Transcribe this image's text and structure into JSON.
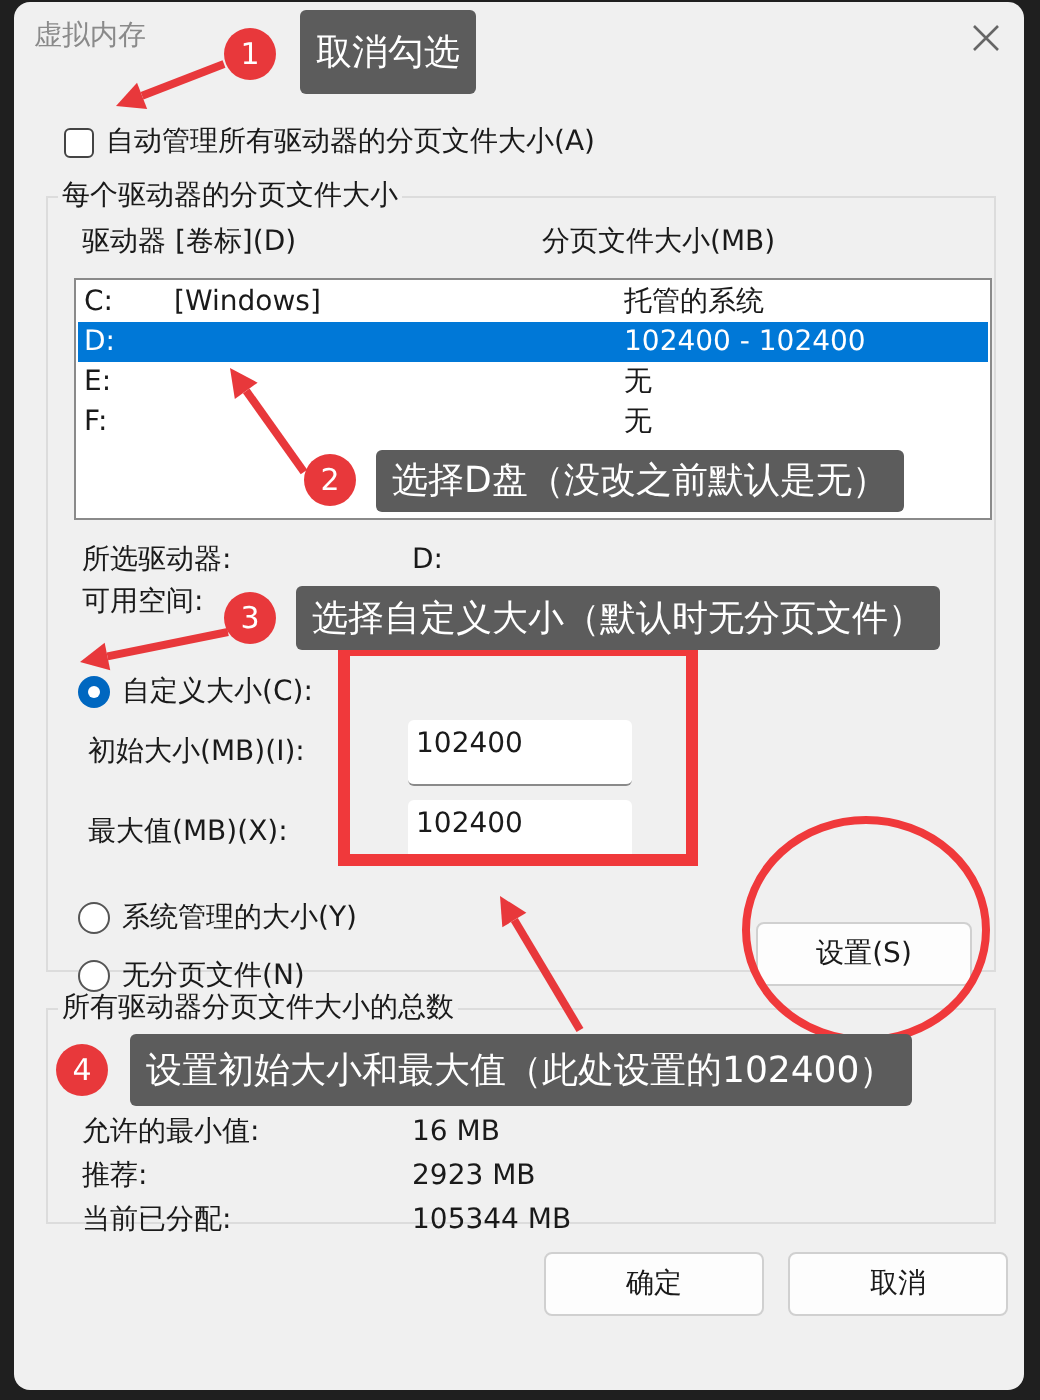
{
  "window": {
    "title": "虚拟内存"
  },
  "auto_manage": {
    "label": "自动管理所有驱动器的分页文件大小(A)",
    "checked": false
  },
  "per_drive": {
    "legend": "每个驱动器的分页文件大小",
    "columns": [
      "驱动器 [卷标](D)",
      "分页文件大小(MB)"
    ],
    "drives": [
      {
        "drive": "C:",
        "label": "[Windows]",
        "size": "托管的系统",
        "selected": false
      },
      {
        "drive": "D:",
        "size": "102400 - 102400",
        "selected": true
      },
      {
        "drive": "E:",
        "size": "无",
        "selected": false
      },
      {
        "drive": "F:",
        "size": "无",
        "selected": false
      }
    ],
    "selected_drive": {
      "label": "所选驱动器:",
      "value": "D:"
    },
    "free_space": {
      "label": "可用空间:"
    },
    "options": [
      {
        "label": "自定义大小(C):",
        "selected": true
      },
      {
        "label": "系统管理的大小(Y)",
        "selected": false
      },
      {
        "label": "无分页文件(N)",
        "selected": false
      }
    ],
    "initial_size": {
      "label": "初始大小(MB)(I):",
      "value": "102400"
    },
    "max_size": {
      "label": "最大值(MB)(X):",
      "value": "102400"
    },
    "set_button": "设置(S)"
  },
  "totals": {
    "legend": "所有驱动器分页文件大小的总数",
    "rows": [
      {
        "label": "允许的最小值:",
        "value": "16 MB"
      },
      {
        "label": "推荐:",
        "value": "2923 MB"
      },
      {
        "label": "当前已分配:",
        "value": "105344 MB"
      }
    ]
  },
  "buttons": [
    "确定",
    "取消"
  ],
  "annotations": [
    {
      "number": "1",
      "text": "取消勾选"
    },
    {
      "number": "2",
      "text": "选择D盘（没改之前默认是无）"
    },
    {
      "number": "3",
      "text": "选择自定义大小（默认时无分页文件）"
    },
    {
      "number": "4",
      "text": "设置初始大小和最大值（此处设置的102400）"
    }
  ]
}
